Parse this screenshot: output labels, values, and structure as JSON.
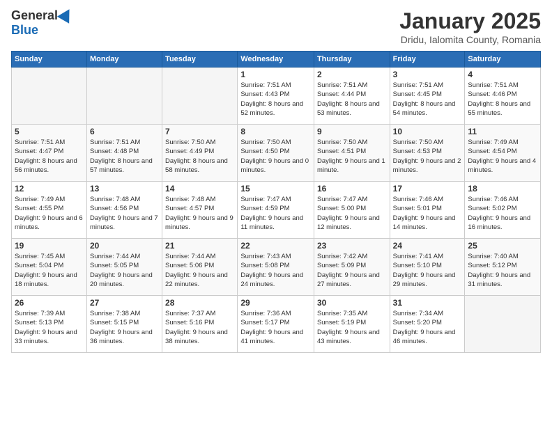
{
  "header": {
    "logo_general": "General",
    "logo_blue": "Blue",
    "month_title": "January 2025",
    "location": "Dridu, Ialomita County, Romania"
  },
  "days_of_week": [
    "Sunday",
    "Monday",
    "Tuesday",
    "Wednesday",
    "Thursday",
    "Friday",
    "Saturday"
  ],
  "weeks": [
    [
      {
        "day": "",
        "empty": true
      },
      {
        "day": "",
        "empty": true
      },
      {
        "day": "",
        "empty": true
      },
      {
        "day": "1",
        "sunrise": "7:51 AM",
        "sunset": "4:43 PM",
        "daylight": "8 hours and 52 minutes."
      },
      {
        "day": "2",
        "sunrise": "7:51 AM",
        "sunset": "4:44 PM",
        "daylight": "8 hours and 53 minutes."
      },
      {
        "day": "3",
        "sunrise": "7:51 AM",
        "sunset": "4:45 PM",
        "daylight": "8 hours and 54 minutes."
      },
      {
        "day": "4",
        "sunrise": "7:51 AM",
        "sunset": "4:46 PM",
        "daylight": "8 hours and 55 minutes."
      }
    ],
    [
      {
        "day": "5",
        "sunrise": "7:51 AM",
        "sunset": "4:47 PM",
        "daylight": "8 hours and 56 minutes."
      },
      {
        "day": "6",
        "sunrise": "7:51 AM",
        "sunset": "4:48 PM",
        "daylight": "8 hours and 57 minutes."
      },
      {
        "day": "7",
        "sunrise": "7:50 AM",
        "sunset": "4:49 PM",
        "daylight": "8 hours and 58 minutes."
      },
      {
        "day": "8",
        "sunrise": "7:50 AM",
        "sunset": "4:50 PM",
        "daylight": "9 hours and 0 minutes."
      },
      {
        "day": "9",
        "sunrise": "7:50 AM",
        "sunset": "4:51 PM",
        "daylight": "9 hours and 1 minute."
      },
      {
        "day": "10",
        "sunrise": "7:50 AM",
        "sunset": "4:53 PM",
        "daylight": "9 hours and 2 minutes."
      },
      {
        "day": "11",
        "sunrise": "7:49 AM",
        "sunset": "4:54 PM",
        "daylight": "9 hours and 4 minutes."
      }
    ],
    [
      {
        "day": "12",
        "sunrise": "7:49 AM",
        "sunset": "4:55 PM",
        "daylight": "9 hours and 6 minutes."
      },
      {
        "day": "13",
        "sunrise": "7:48 AM",
        "sunset": "4:56 PM",
        "daylight": "9 hours and 7 minutes."
      },
      {
        "day": "14",
        "sunrise": "7:48 AM",
        "sunset": "4:57 PM",
        "daylight": "9 hours and 9 minutes."
      },
      {
        "day": "15",
        "sunrise": "7:47 AM",
        "sunset": "4:59 PM",
        "daylight": "9 hours and 11 minutes."
      },
      {
        "day": "16",
        "sunrise": "7:47 AM",
        "sunset": "5:00 PM",
        "daylight": "9 hours and 12 minutes."
      },
      {
        "day": "17",
        "sunrise": "7:46 AM",
        "sunset": "5:01 PM",
        "daylight": "9 hours and 14 minutes."
      },
      {
        "day": "18",
        "sunrise": "7:46 AM",
        "sunset": "5:02 PM",
        "daylight": "9 hours and 16 minutes."
      }
    ],
    [
      {
        "day": "19",
        "sunrise": "7:45 AM",
        "sunset": "5:04 PM",
        "daylight": "9 hours and 18 minutes."
      },
      {
        "day": "20",
        "sunrise": "7:44 AM",
        "sunset": "5:05 PM",
        "daylight": "9 hours and 20 minutes."
      },
      {
        "day": "21",
        "sunrise": "7:44 AM",
        "sunset": "5:06 PM",
        "daylight": "9 hours and 22 minutes."
      },
      {
        "day": "22",
        "sunrise": "7:43 AM",
        "sunset": "5:08 PM",
        "daylight": "9 hours and 24 minutes."
      },
      {
        "day": "23",
        "sunrise": "7:42 AM",
        "sunset": "5:09 PM",
        "daylight": "9 hours and 27 minutes."
      },
      {
        "day": "24",
        "sunrise": "7:41 AM",
        "sunset": "5:10 PM",
        "daylight": "9 hours and 29 minutes."
      },
      {
        "day": "25",
        "sunrise": "7:40 AM",
        "sunset": "5:12 PM",
        "daylight": "9 hours and 31 minutes."
      }
    ],
    [
      {
        "day": "26",
        "sunrise": "7:39 AM",
        "sunset": "5:13 PM",
        "daylight": "9 hours and 33 minutes."
      },
      {
        "day": "27",
        "sunrise": "7:38 AM",
        "sunset": "5:15 PM",
        "daylight": "9 hours and 36 minutes."
      },
      {
        "day": "28",
        "sunrise": "7:37 AM",
        "sunset": "5:16 PM",
        "daylight": "9 hours and 38 minutes."
      },
      {
        "day": "29",
        "sunrise": "7:36 AM",
        "sunset": "5:17 PM",
        "daylight": "9 hours and 41 minutes."
      },
      {
        "day": "30",
        "sunrise": "7:35 AM",
        "sunset": "5:19 PM",
        "daylight": "9 hours and 43 minutes."
      },
      {
        "day": "31",
        "sunrise": "7:34 AM",
        "sunset": "5:20 PM",
        "daylight": "9 hours and 46 minutes."
      },
      {
        "day": "",
        "empty": true
      }
    ]
  ]
}
